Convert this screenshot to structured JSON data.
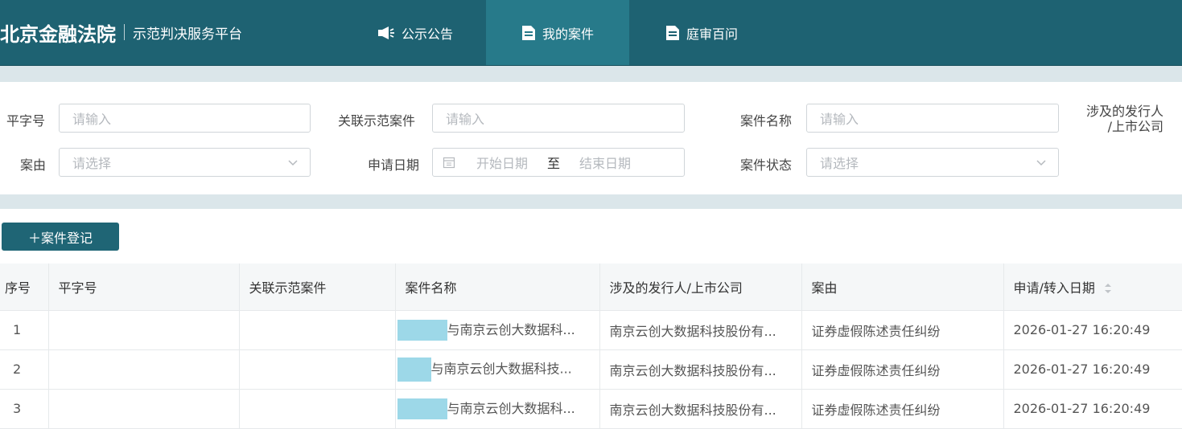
{
  "header": {
    "brand": "北京金融法院",
    "subtitle": "示范判决服务平台",
    "nav": [
      {
        "label": "公示公告",
        "icon": "megaphone-icon",
        "active": false
      },
      {
        "label": "我的案件",
        "icon": "document-icon",
        "active": true
      },
      {
        "label": "庭审百问",
        "icon": "document-icon",
        "active": false
      }
    ]
  },
  "filters": {
    "ping_zi_hao": {
      "label": "平字号",
      "placeholder": "请输入"
    },
    "related_case": {
      "label": "关联示范案件",
      "placeholder": "请输入"
    },
    "case_name": {
      "label": "案件名称",
      "placeholder": "请输入"
    },
    "issuer": {
      "label_line1": "涉及的发行人",
      "label_line2": "/上市公司"
    },
    "cause": {
      "label": "案由",
      "placeholder": "请选择"
    },
    "apply_date": {
      "label": "申请日期",
      "start": "开始日期",
      "separator": "至",
      "end": "结束日期"
    },
    "status": {
      "label": "案件状态",
      "placeholder": "请选择"
    }
  },
  "actions": {
    "register": "＋案件登记"
  },
  "table": {
    "columns": [
      "序号",
      "平字号",
      "关联示范案件",
      "案件名称",
      "涉及的发行人/上市公司",
      "案由",
      "申请/转入日期"
    ],
    "rows": [
      {
        "index": "1",
        "ping_zi_hao": "",
        "related": "",
        "name": "与南京云创大数据科...",
        "issuer": "南京云创大数据科技股份有...",
        "cause": "证券虚假陈述责任纠纷",
        "date": "2026-01-27 16:20:49"
      },
      {
        "index": "2",
        "ping_zi_hao": "",
        "related": "",
        "name": "与南京云创大数据科技...",
        "issuer": "南京云创大数据科技股份有...",
        "cause": "证券虚假陈述责任纠纷",
        "date": "2026-01-27 16:20:49"
      },
      {
        "index": "3",
        "ping_zi_hao": "",
        "related": "",
        "name": "与南京云创大数据科...",
        "issuer": "南京云创大数据科技股份有...",
        "cause": "证券虚假陈述责任纠纷",
        "date": "2026-01-27 16:20:49"
      }
    ]
  },
  "colors": {
    "header_bg": "#1e6272",
    "nav_active": "#277a8a",
    "button_bg": "#1f6575",
    "redaction": "#9dd8e8"
  }
}
